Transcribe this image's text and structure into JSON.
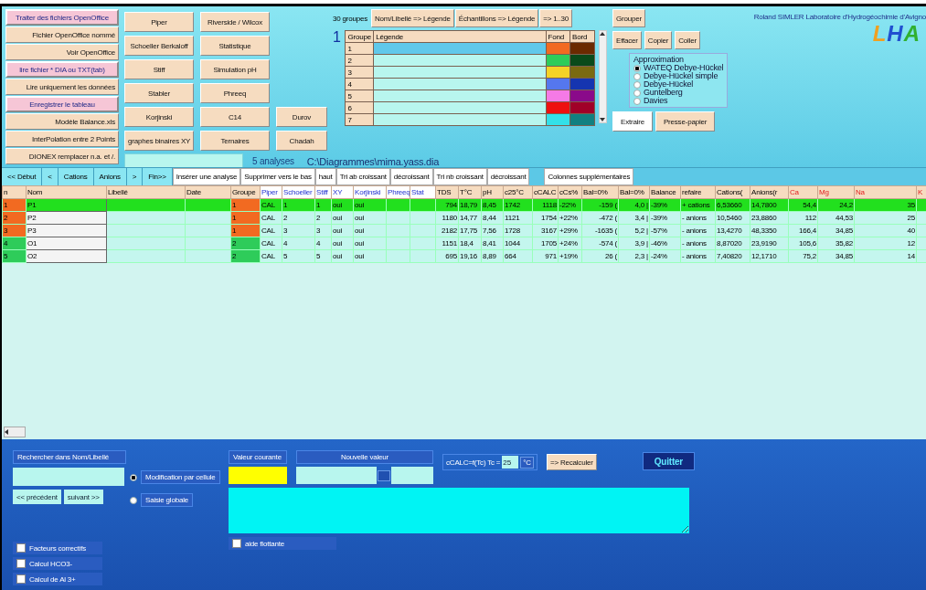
{
  "file_buttons": [
    {
      "label": "Traiter des fichiers OpenOffice",
      "kind": "pink"
    },
    {
      "label": "Fichier OpenOffice nommé",
      "kind": "plain"
    },
    {
      "label": "Voir OpenOffice",
      "kind": "plain"
    },
    {
      "label": "lire fichier * DIA ou TXT(tab)",
      "kind": "pink"
    },
    {
      "label": "Lire uniquement les données",
      "kind": "plain"
    },
    {
      "label": "Enregistrer le tableau",
      "kind": "pink"
    },
    {
      "label": "Modèle Balance.xls",
      "kind": "plain"
    },
    {
      "label": "InterPolation entre 2 Points",
      "kind": "plain"
    },
    {
      "label": "DIONEX remplacer n.a. et /.",
      "kind": "plain"
    }
  ],
  "diagram_buttons": [
    [
      "Piper",
      "Schoeller Berkaloff",
      "Stiff",
      "Stabler",
      "Korjinski",
      "graphes binaires XY"
    ],
    [
      "Riverside / Wilcox",
      "Statistique",
      "Simulation pH",
      "Phreeq",
      "C14",
      "Ternaires"
    ],
    [
      "Durov",
      "Chadah"
    ]
  ],
  "analyses_count": "5 analyses",
  "file_path": "C:\\Diagrammes\\mima.yass.dia",
  "groups": {
    "count": "30 groupes",
    "buttons": [
      "Nom/Libellé => Légende",
      "Échantillons => Légende",
      "=> 1..30"
    ],
    "current": "1",
    "columns": [
      "Groupe",
      "Légende",
      "Fond",
      "Bord"
    ],
    "rows": [
      {
        "number": "1",
        "selected": true,
        "swatches": [
          {
            "color": "#f26a21"
          },
          {
            "color": "#6b2a00"
          }
        ]
      },
      {
        "number": "2",
        "selected": false,
        "swatches": [
          {
            "color": "#2ecc5a"
          },
          {
            "color": "#0a4a1a"
          }
        ]
      },
      {
        "number": "3",
        "selected": false,
        "swatches": [
          {
            "color": "#f5d327"
          },
          {
            "color": "#7a6a10"
          }
        ]
      },
      {
        "number": "4",
        "selected": false,
        "swatches": [
          {
            "color": "#5577ee"
          },
          {
            "color": "#1535b0"
          }
        ]
      },
      {
        "number": "5",
        "selected": false,
        "swatches": [
          {
            "color": "#f57ae6"
          },
          {
            "color": "#8a0a8a"
          }
        ]
      },
      {
        "number": "6",
        "selected": false,
        "swatches": [
          {
            "color": "#ee1010"
          },
          {
            "color": "#a00028"
          }
        ]
      },
      {
        "number": "7",
        "selected": false,
        "swatches": [
          {
            "color": "#33e0e8"
          },
          {
            "color": "#118080"
          }
        ]
      }
    ]
  },
  "group_button": "Grouper",
  "edit_buttons": [
    "Effacer",
    "Copier",
    "Coller"
  ],
  "approximation": {
    "title": "Approximation",
    "options": [
      {
        "label": "WATEQ Debye-Hückel",
        "selected": true
      },
      {
        "label": "Debye-Hückel simple",
        "selected": false
      },
      {
        "label": "Debye-Hückel",
        "selected": false
      },
      {
        "label": "Guntelberg",
        "selected": false
      },
      {
        "label": "Davies",
        "selected": false
      }
    ]
  },
  "export_buttons": [
    {
      "label": "Extraire",
      "kind": "white"
    },
    {
      "label": "Presse-papier",
      "kind": "peach"
    }
  ],
  "author": "Roland SIMLER Laboratoire d'Hydrogéochimie d'Avigno",
  "logo": "LHA",
  "nav_buttons": [
    "<< Début",
    "<",
    "Cations",
    "Anions",
    ">",
    "Fin>>"
  ],
  "action_buttons": [
    "Insérer une analyse",
    "Supprimer vers le bas",
    "haut",
    "Tri ab croissant",
    "décroissant",
    "Tri nb croissant",
    "décroissant"
  ],
  "extra_columns_button": "Colonnes supplémentaires",
  "table": {
    "columns": [
      {
        "label": "n",
        "kind": "index"
      },
      {
        "label": "Nom",
        "kind": "name"
      },
      {
        "label": "Libellé",
        "kind": "text"
      },
      {
        "label": "Date",
        "kind": "text"
      },
      {
        "label": "Groupe",
        "kind": "group"
      },
      {
        "label": "Piper",
        "kind": "diagram"
      },
      {
        "label": "Schoeller",
        "kind": "diagram"
      },
      {
        "label": "Stiff",
        "kind": "diagram"
      },
      {
        "label": "XY",
        "kind": "diagram"
      },
      {
        "label": "Korjinski",
        "kind": "diagram"
      },
      {
        "label": "Phreeq",
        "kind": "diagram"
      },
      {
        "label": "Stat",
        "kind": "diagram"
      },
      {
        "label": "TDS",
        "kind": "number"
      },
      {
        "label": "T°C",
        "kind": "text"
      },
      {
        "label": "pH",
        "kind": "text"
      },
      {
        "label": "c25°C",
        "kind": "text"
      },
      {
        "label": "cCALC",
        "kind": "number"
      },
      {
        "label": "cCs%",
        "kind": "text"
      },
      {
        "label": "Bal=0%",
        "kind": "number"
      },
      {
        "label": "Bal=0%",
        "kind": "number"
      },
      {
        "label": "Balance",
        "kind": "text"
      },
      {
        "label": "refaire",
        "kind": "text"
      },
      {
        "label": "Cations(",
        "kind": "text"
      },
      {
        "label": "Anions(r",
        "kind": "text"
      },
      {
        "label": "Ca",
        "kind": "element"
      },
      {
        "label": "Mg",
        "kind": "element"
      },
      {
        "label": "Na",
        "kind": "element"
      },
      {
        "label": "K",
        "kind": "element"
      }
    ],
    "rows": [
      {
        "selected": true,
        "focused": true,
        "color": "#f26a21",
        "cells": [
          "1",
          "P1",
          "",
          "",
          "1",
          "CAL",
          "1",
          "1",
          "oui",
          "oui",
          "",
          "",
          "794",
          "18,79",
          "8,45",
          "1742",
          "1118",
          "-22%",
          "-159 (",
          "4,0 |",
          "-39%",
          "+ cations",
          "6,53660",
          "14,7800",
          "54,4",
          "24,2",
          "35",
          ""
        ]
      },
      {
        "selected": false,
        "focused": false,
        "color": "#f26a21",
        "cells": [
          "2",
          "P2",
          "",
          "",
          "1",
          "CAL",
          "2",
          "2",
          "oui",
          "oui",
          "",
          "",
          "1180",
          "14,77",
          "8,44",
          "1121",
          "1754",
          "+22%",
          "-472 (",
          "3,4 |",
          "-39%",
          "- anions",
          "10,5460",
          "23,8860",
          "112",
          "44,53",
          "25",
          ""
        ]
      },
      {
        "selected": false,
        "focused": false,
        "color": "#f26a21",
        "cells": [
          "3",
          "P3",
          "",
          "",
          "1",
          "CAL",
          "3",
          "3",
          "oui",
          "oui",
          "",
          "",
          "2182",
          "17,75",
          "7,56",
          "1728",
          "3167",
          "+29%",
          "-1635 (",
          "5,2 |",
          "-57%",
          "- anions",
          "13,4270",
          "48,3350",
          "166,4",
          "34,85",
          "40",
          ""
        ]
      },
      {
        "selected": false,
        "focused": false,
        "color": "#2ecc5a",
        "cells": [
          "4",
          "O1",
          "",
          "",
          "2",
          "CAL",
          "4",
          "4",
          "oui",
          "oui",
          "",
          "",
          "1151",
          "18,4",
          "8,41",
          "1044",
          "1705",
          "+24%",
          "-574 (",
          "3,9 |",
          "-46%",
          "- anions",
          "8,87020",
          "23,9190",
          "105,6",
          "35,82",
          "12",
          ""
        ]
      },
      {
        "selected": false,
        "focused": false,
        "color": "#2ecc5a",
        "cells": [
          "5",
          "O2",
          "",
          "",
          "2",
          "CAL",
          "5",
          "5",
          "oui",
          "oui",
          "",
          "",
          "695",
          "19,16",
          "8,89",
          "664",
          "971",
          "+19%",
          "26 (",
          "2,3 |",
          "-24%",
          "- anions",
          "7,40820",
          "12,1710",
          "75,2",
          "34,85",
          "14",
          ""
        ]
      }
    ]
  },
  "bottom": {
    "search_label": "Rechercher dans Nom/Libellé",
    "search_buttons": [
      "<< précédent",
      "suivant >>"
    ],
    "edit_modes": [
      {
        "label": "Modification par cellule",
        "selected": true
      },
      {
        "label": "Saisie globale",
        "selected": false
      }
    ],
    "current_value_label": "Valeur courante",
    "new_value_label": "Nouvelle valeur",
    "temperature_label": "cCALC=f(Tc) Tc =",
    "temperature_value": "25",
    "temperature_unit": "°C",
    "recalc_button": "=> Recalculer",
    "quit_button": "Quitter",
    "floating_help": {
      "label": "aide flottante",
      "checked": false
    },
    "options": [
      {
        "label": "Facteurs correctifs",
        "checked": false
      },
      {
        "label": "Calcul HCO3-",
        "checked": false
      },
      {
        "label": "Calcul de Al 3+",
        "checked": false
      }
    ]
  }
}
